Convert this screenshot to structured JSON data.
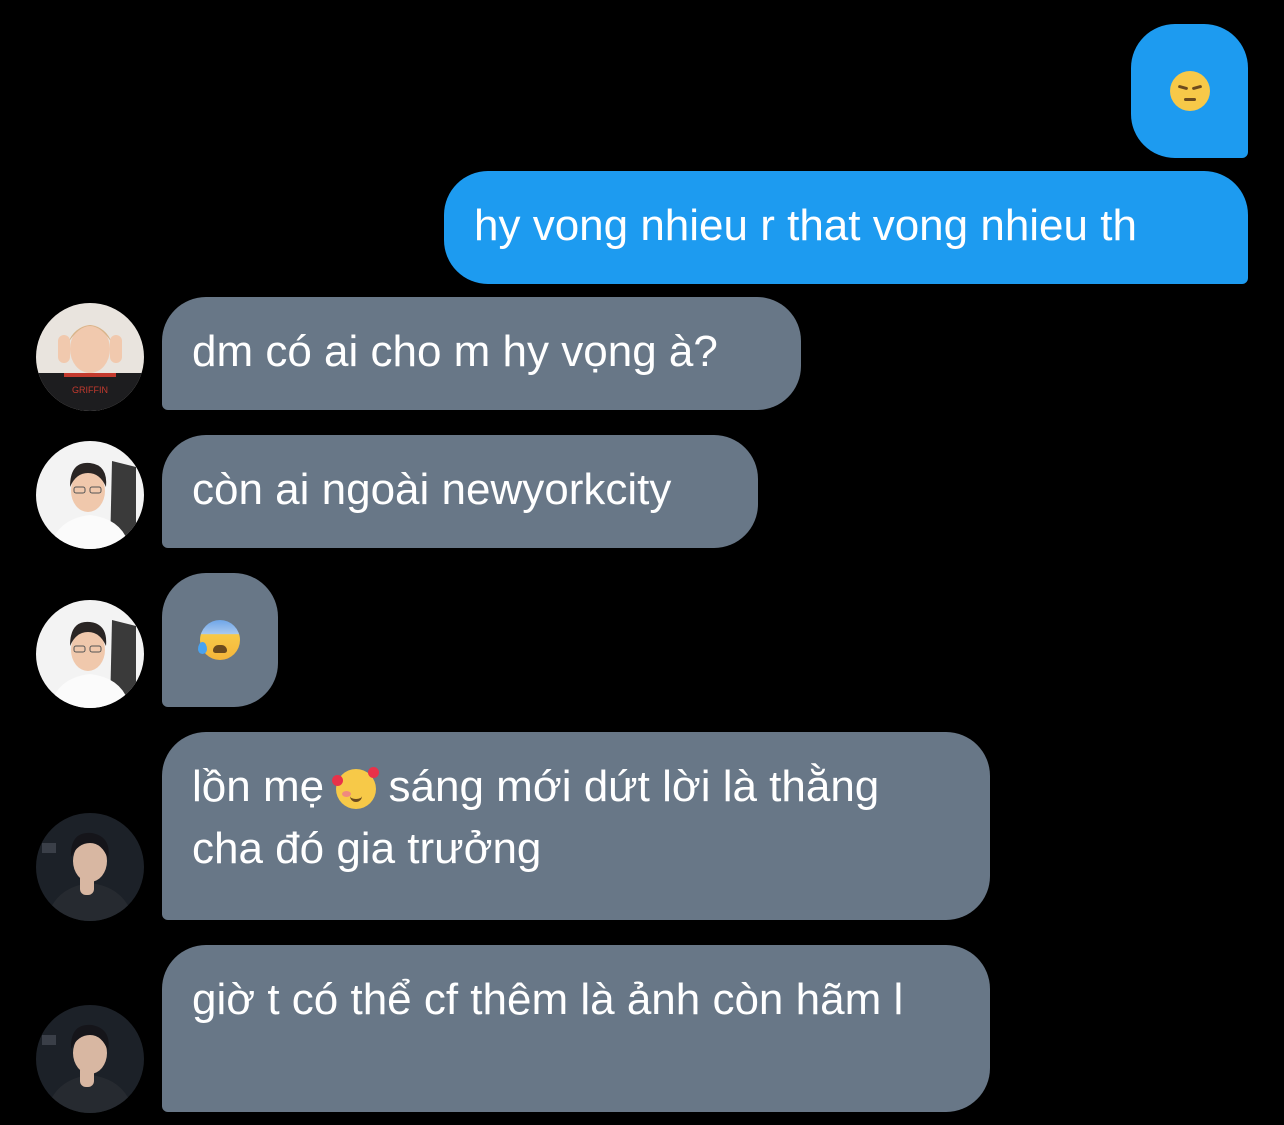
{
  "messages": [
    {
      "id": "m1",
      "direction": "sent",
      "text": "",
      "emoji": "pensive-face"
    },
    {
      "id": "m2",
      "direction": "sent",
      "text": "hy vong nhieu r that vong nhieu th"
    },
    {
      "id": "m3",
      "direction": "received",
      "text": "dm có ai cho m hy vọng à?",
      "avatar": "avatar-griffin"
    },
    {
      "id": "m4",
      "direction": "received",
      "text": "còn ai ngoài newyorkcity",
      "avatar": "avatar-light"
    },
    {
      "id": "m5",
      "direction": "received",
      "text": "",
      "emoji": "anxious-face-with-sweat",
      "avatar": "avatar-light"
    },
    {
      "id": "m6",
      "direction": "received",
      "text_before_emoji": "lồn mẹ",
      "emoji": "smiling-face-with-hearts",
      "text_after_emoji": "sáng mới dứt lời là thằng cha đó gia trưởng",
      "avatar": "avatar-dark"
    },
    {
      "id": "m7",
      "direction": "received",
      "text": "giờ t có thể cf thêm là ảnh còn hãm l",
      "avatar": "avatar-dark"
    }
  ],
  "colors": {
    "background": "#000000",
    "sent_bubble": "#1d9bf0",
    "received_bubble": "#687787",
    "text": "#ffffff"
  },
  "avatar_badge": "GRIFFIN"
}
